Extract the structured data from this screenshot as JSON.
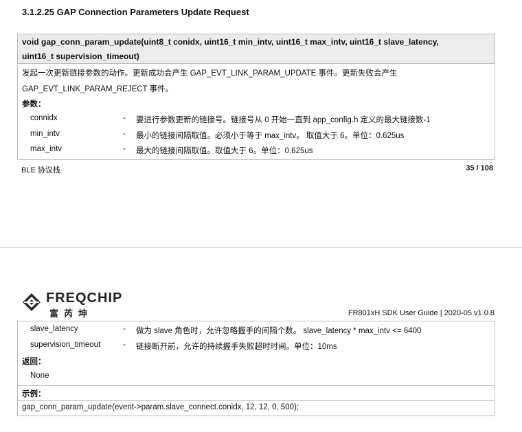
{
  "section_title": "3.1.2.25 GAP Connection Parameters Update Request",
  "signature": {
    "line1": "void gap_conn_param_update(uint8_t conidx, uint16_t min_intv, uint16_t max_intv, uint16_t slave_latency,",
    "line2": "uint16_t supervision_timeout)"
  },
  "description": {
    "line1": "发起一次更新链接参数的动作。更新成功会产生 GAP_EVT_LINK_PARAM_UPDATE 事件。更新失败会产生",
    "line2": "GAP_EVT_LINK_PARAM_REJECT 事件。"
  },
  "params_label": "参数：",
  "params_page1": [
    {
      "name": "connidx",
      "dash": "-",
      "desc": "要进行参数更新的链接号。链接号从 0 开始一直到 app_config.h 定义的最大链接数-1"
    },
    {
      "name": "min_intv",
      "dash": "-",
      "desc": "最小的链接间隔取值。必须小于等于 max_intv。 取值大于 6。单位：0.625us"
    },
    {
      "name": "max_intv",
      "dash": "-",
      "desc": "最大的链接间隔取值。取值大于 6。单位：0.625us"
    }
  ],
  "footer": {
    "left": "BLE 协议栈",
    "right": "35 / 108"
  },
  "logo": {
    "text_en": "FREQCHIP",
    "text_cn": "富芮坤",
    "icon": "freqchip-diamond-logo"
  },
  "header2_right": "FR801xH SDK User Guide | 2020-05 v1.0.8",
  "params_page2": [
    {
      "name": "slave_latency",
      "dash": "-",
      "desc": "做为 slave 角色时，允许忽略握手的间隔个数。 slave_latency * max_intv <= 6400"
    },
    {
      "name": "supervision_timeout",
      "dash": "-",
      "desc": "链接断开前，允许的持续握手失败超时时间。单位：10ms"
    }
  ],
  "returns_label": "返回：",
  "returns_value": "None",
  "example_label": "示例：",
  "example_code": "gap_conn_param_update(event->param.slave_connect.conidx, 12, 12, 0, 500);"
}
